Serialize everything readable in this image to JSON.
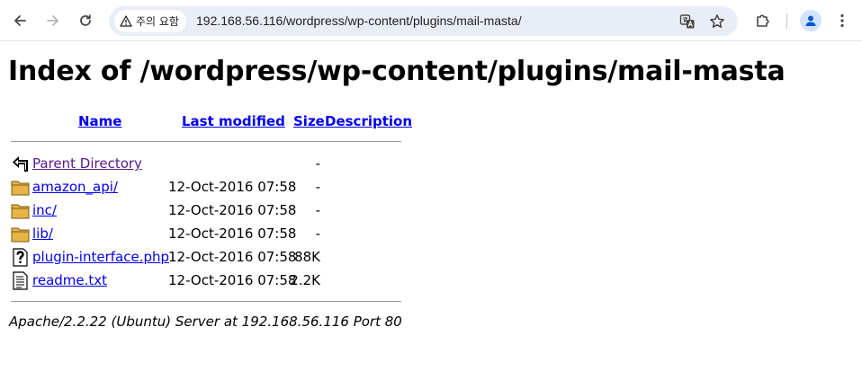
{
  "browser": {
    "security_label": "주의 요함",
    "url": "192.168.56.116/wordpress/wp-content/plugins/mail-masta/"
  },
  "page": {
    "title": "Index of /wordpress/wp-content/plugins/mail-masta",
    "columns": {
      "name": "Name",
      "last_modified": "Last modified",
      "size": "Size",
      "description": "Description"
    },
    "rows": [
      {
        "name": "Parent Directory",
        "modified": "",
        "size": "-",
        "icon": "back-icon"
      },
      {
        "name": "amazon_api/",
        "modified": "12-Oct-2016 07:58",
        "size": "-",
        "icon": "folder-icon"
      },
      {
        "name": "inc/",
        "modified": "12-Oct-2016 07:58",
        "size": "-",
        "icon": "folder-icon"
      },
      {
        "name": "lib/",
        "modified": "12-Oct-2016 07:58",
        "size": "-",
        "icon": "folder-icon"
      },
      {
        "name": "plugin-interface.php",
        "modified": "12-Oct-2016 07:58",
        "size": "88K",
        "icon": "unknown-file-icon"
      },
      {
        "name": "readme.txt",
        "modified": "12-Oct-2016 07:58",
        "size": "2.2K",
        "icon": "text-file-icon"
      }
    ],
    "footer": "Apache/2.2.22 (Ubuntu) Server at 192.168.56.116 Port 80"
  },
  "colors": {
    "link": "#0000ee",
    "visited_link": "#551a8b",
    "omnibox_bg": "#e9eef6",
    "folder": "#e8b448"
  }
}
